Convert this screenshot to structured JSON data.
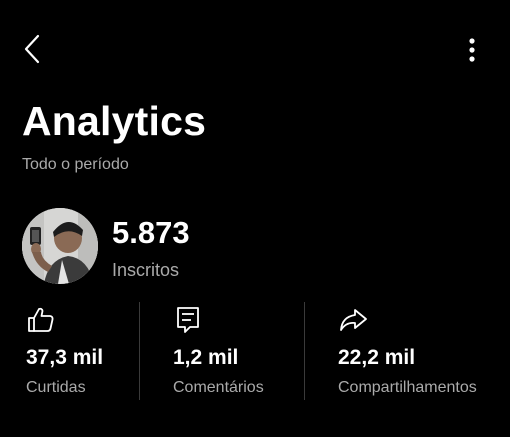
{
  "header": {
    "back_icon": "chevron-left-icon",
    "more_icon": "more-vertical-icon"
  },
  "page": {
    "title": "Analytics",
    "period": "Todo o período"
  },
  "channel": {
    "subscribers_value": "5.873",
    "subscribers_label": "Inscritos"
  },
  "stats": [
    {
      "icon": "thumbs-up-icon",
      "value": "37,3 mil",
      "label": "Curtidas"
    },
    {
      "icon": "comment-icon",
      "value": "1,2 mil",
      "label": "Comentários"
    },
    {
      "icon": "share-icon",
      "value": "22,2 mil",
      "label": "Compartilhamentos"
    }
  ],
  "colors": {
    "background": "#000000",
    "primary_text": "#ffffff",
    "secondary_text": "#aaaaaa",
    "divider": "#3a3a3a"
  }
}
